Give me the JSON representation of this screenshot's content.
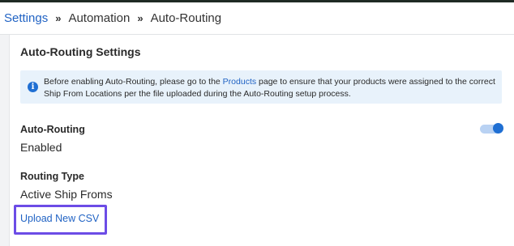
{
  "breadcrumb": {
    "items": [
      "Settings",
      "Automation",
      "Auto-Routing"
    ],
    "separator": "»"
  },
  "panel": {
    "title": "Auto-Routing Settings"
  },
  "info": {
    "text_before": "Before enabling Auto-Routing, please go to the ",
    "link": "Products",
    "text_after": " page to ensure that your products were assigned to the correct Ship From Locations per the file uploaded during the Auto-Routing setup process.",
    "icon": "info-icon"
  },
  "auto_routing": {
    "label": "Auto-Routing",
    "value": "Enabled",
    "toggle_on": true
  },
  "routing_type": {
    "label": "Routing Type",
    "value": "Active Ship Froms"
  },
  "upload": {
    "label": "Upload New CSV"
  },
  "colors": {
    "accent": "#2163c4",
    "highlight": "#6c4ce6",
    "info_bg": "#e8f2fb"
  }
}
